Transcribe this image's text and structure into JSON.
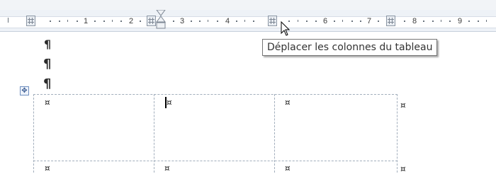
{
  "ruler": {
    "numbers": [
      "1",
      "2",
      "3",
      "4",
      "6",
      "7",
      "8",
      "9"
    ]
  },
  "tooltip": {
    "text": "Déplacer les colonnes du tableau"
  },
  "document": {
    "paragraph_mark": "¶",
    "cell_mark": "¤",
    "move_handle_glyph": "✥",
    "cells": [
      "¤",
      "¤",
      "¤",
      "¤",
      "¤",
      "¤",
      "¤",
      "¤"
    ]
  }
}
